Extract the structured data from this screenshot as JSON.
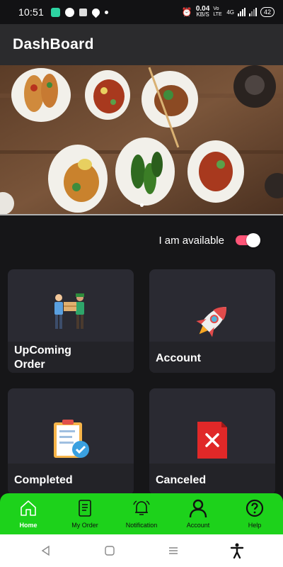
{
  "status_bar": {
    "time": "10:51",
    "net_speed_value": "0.04",
    "net_speed_unit": "KB/S",
    "net_type": "Vo LTE",
    "signal": "4G",
    "battery": "42"
  },
  "app_bar": {
    "title": "DashBoard"
  },
  "availability": {
    "label": "I am available",
    "enabled": true,
    "toggle_color": "#ff5577"
  },
  "cards": [
    {
      "label": "UpComing Order",
      "icon": "delivery-handover-illustration"
    },
    {
      "label": "Account",
      "icon": "rocket-illustration"
    },
    {
      "label": "Completed",
      "icon": "clipboard-check-illustration"
    },
    {
      "label": "Canceled",
      "icon": "cancelled-document-illustration"
    }
  ],
  "bottom_nav": {
    "accent_color": "#1dd21b",
    "active_index": 0,
    "items": [
      {
        "label": "Home",
        "icon": "home-icon"
      },
      {
        "label": "My Order",
        "icon": "order-document-icon"
      },
      {
        "label": "Notification",
        "icon": "bell-icon"
      },
      {
        "label": "Account",
        "icon": "person-icon"
      },
      {
        "label": "Help",
        "icon": "help-icon"
      }
    ]
  },
  "system_nav": {
    "icons": [
      "back-icon",
      "home-square-icon",
      "recents-icon",
      "accessibility-icon"
    ]
  }
}
